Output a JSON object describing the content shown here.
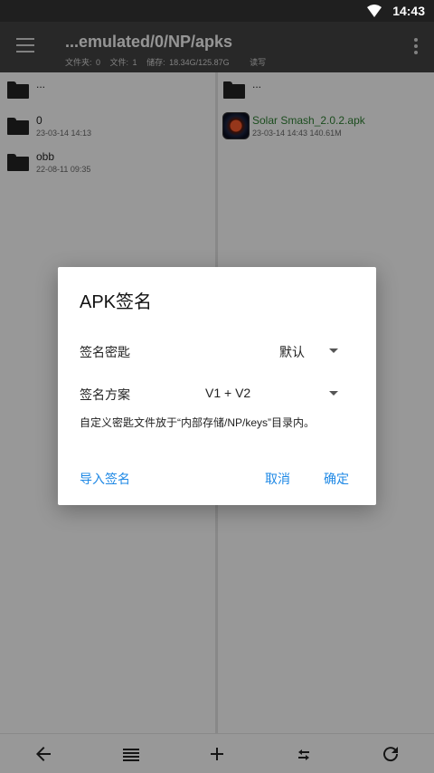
{
  "status": {
    "time": "14:43"
  },
  "appbar": {
    "path": "...emulated/0/NP/apks",
    "folders": "文件夹: 0",
    "files": "文件: 1",
    "storage": "储存: 18.34G/125.87G",
    "mode": "读写"
  },
  "left": {
    "rows": [
      {
        "name": "...",
        "meta": ""
      },
      {
        "name": "0",
        "meta": "23-03-14 14:13"
      },
      {
        "name": "obb",
        "meta": "22-08-11 09:35"
      }
    ]
  },
  "right": {
    "rows": [
      {
        "name": "...",
        "meta": ""
      },
      {
        "name": "Solar Smash_2.0.2.apk",
        "meta": "23-03-14 14:43  140.61M"
      }
    ]
  },
  "dialog": {
    "title": "APK签名",
    "key_label": "签名密匙",
    "key_value": "默认",
    "scheme_label": "签名方案",
    "scheme_value": "V1 + V2",
    "note": "自定义密匙文件放于“内部存储/NP/keys”目录内。",
    "import": "导入签名",
    "cancel": "取消",
    "ok": "确定",
    "accent": "#1e88e5"
  },
  "bottombar": {
    "icons": [
      "arrow-left-icon",
      "list-icon",
      "plus-icon",
      "swap-icon",
      "refresh-icon"
    ]
  }
}
